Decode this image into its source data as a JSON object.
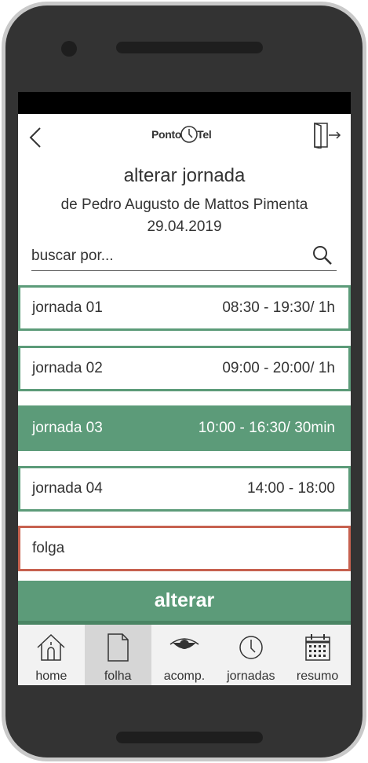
{
  "header": {
    "logo_left": "Ponto",
    "logo_right": "Tel"
  },
  "page": {
    "title": "alterar jornada",
    "subtitle": "de Pedro Augusto de Mattos Pimenta",
    "date": "29.04.2019"
  },
  "search": {
    "placeholder": "buscar por..."
  },
  "options": [
    {
      "label": "jornada 01",
      "time": "08:30 - 19:30/ 1h"
    },
    {
      "label": "jornada 02",
      "time": "09:00 - 20:00/ 1h"
    },
    {
      "label": "jornada 03",
      "time": "10:00 - 16:30/ 30min"
    },
    {
      "label": "jornada 04",
      "time": "14:00 - 18:00"
    },
    {
      "label": "folga",
      "time": ""
    }
  ],
  "submit_label": "alterar",
  "tabs": [
    {
      "label": "home",
      "icon": "home-icon"
    },
    {
      "label": "folha",
      "icon": "document-icon"
    },
    {
      "label": "acomp.",
      "icon": "eye-icon"
    },
    {
      "label": "jornadas",
      "icon": "clock-icon"
    },
    {
      "label": "resumo",
      "icon": "calendar-icon"
    }
  ],
  "colors": {
    "accent": "#5c9b79",
    "danger": "#c7614f"
  }
}
